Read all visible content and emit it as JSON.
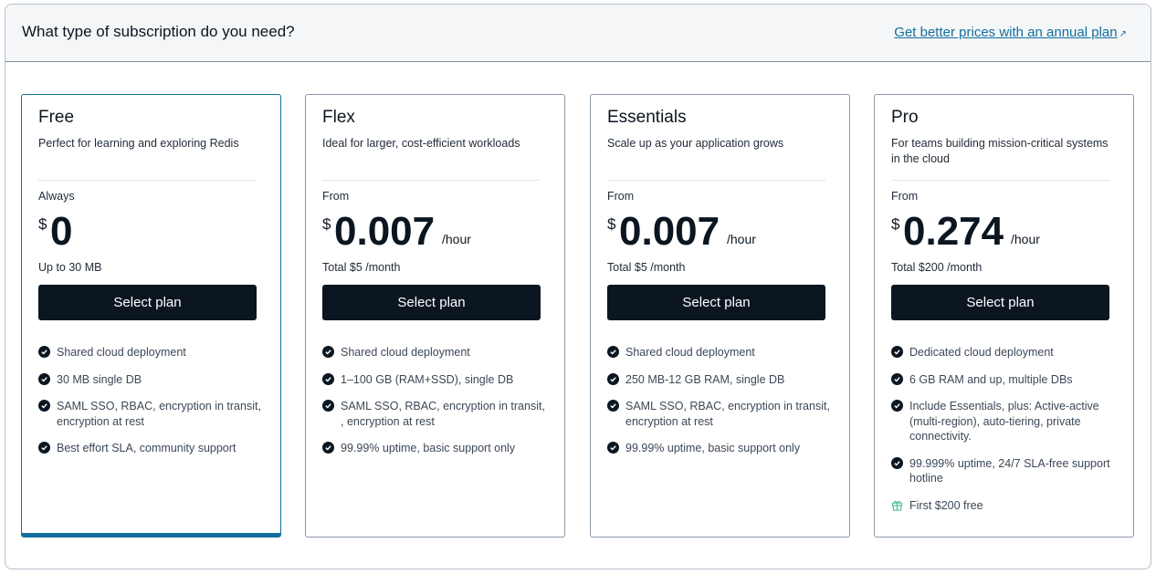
{
  "header": {
    "title": "What type of subscription do you need?",
    "annual_link": "Get better prices with an annual plan",
    "annual_link_icon": "external-link-icon"
  },
  "colors": {
    "accent": "#136f9d",
    "button_bg": "#0b1621",
    "gift_icon": "#3fb78d"
  },
  "plans": [
    {
      "name": "Free",
      "description": "Perfect for learning and exploring Redis",
      "price_prefix": "Always",
      "currency": "$",
      "amount": "0",
      "unit": "",
      "note": "Up to 30 MB",
      "button": "Select plan",
      "selected": true,
      "features": [
        "Shared cloud deployment",
        "30 MB single DB",
        "SAML SSO, RBAC, encryption in transit, encryption at rest",
        "Best effort SLA, community support"
      ]
    },
    {
      "name": "Flex",
      "description": "Ideal for larger, cost-efficient workloads",
      "price_prefix": "From",
      "currency": "$",
      "amount": "0.007",
      "unit": "/hour",
      "note": "Total $5 /month",
      "button": "Select plan",
      "selected": false,
      "features": [
        "Shared cloud deployment",
        "1–100 GB (RAM+SSD), single DB",
        "SAML SSO, RBAC, encryption in transit, , encryption at rest",
        "99.99% uptime, basic support only"
      ]
    },
    {
      "name": "Essentials",
      "description": "Scale up as your application grows",
      "price_prefix": "From",
      "currency": "$",
      "amount": "0.007",
      "unit": "/hour",
      "note": "Total $5 /month",
      "button": "Select plan",
      "selected": false,
      "features": [
        "Shared cloud deployment",
        "250 MB-12 GB RAM, single DB",
        "SAML SSO, RBAC, encryption in transit, encryption at rest",
        "99.99% uptime, basic support only"
      ]
    },
    {
      "name": "Pro",
      "description": "For teams building mission-critical systems in the cloud",
      "price_prefix": "From",
      "currency": "$",
      "amount": "0.274",
      "unit": "/hour",
      "note": "Total $200 /month",
      "button": "Select plan",
      "selected": false,
      "features": [
        "Dedicated cloud deployment",
        "6 GB RAM and up, multiple DBs",
        "Include Essentials, plus: Active-active (multi-region), auto-tiering, private connectivity.",
        "99.999% uptime, 24/7 SLA-free support hotline"
      ],
      "bonus": "First $200 free",
      "bonus_icon": "gift-icon"
    }
  ]
}
